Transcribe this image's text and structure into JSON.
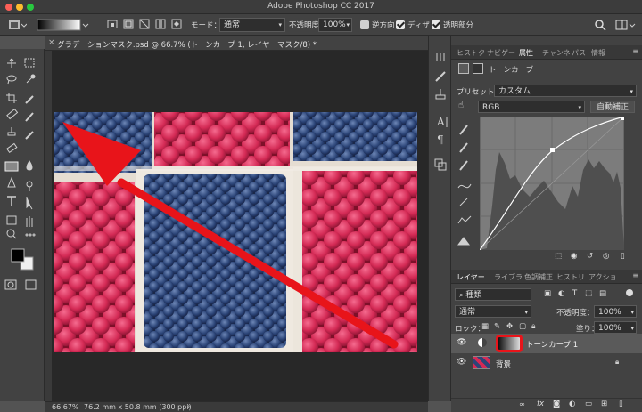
{
  "app": {
    "title": "Adobe Photoshop CC 2017"
  },
  "options_bar": {
    "mode_label": "モード：",
    "mode_value": "通常",
    "opacity_label": "不透明度：",
    "opacity_value": "100%",
    "reverse_label": "逆方向",
    "dither_label": "ディザ",
    "transparency_label": "透明部分"
  },
  "document": {
    "tab_title": "グラデーションマスク.psd @ 66.7% (トーンカーブ 1, レイヤーマスク/8) *",
    "zoom": "66.67%",
    "size_info": "76.2 mm x 50.8 mm (300 ppi)"
  },
  "properties_panel": {
    "tabs": [
      "ヒストク",
      "ナビゲー",
      "属性",
      "チャンネ",
      "パス",
      "情報"
    ],
    "active_tab": "属性",
    "header_label": "トーンカーブ",
    "preset_label": "プリセット：",
    "preset_value": "カスタム",
    "channel_value": "RGB",
    "auto_button": "自動補正"
  },
  "layers_panel": {
    "tabs": [
      "レイヤー",
      "ライブラ",
      "色調補正",
      "ヒストリ",
      "アクショ"
    ],
    "active_tab": "レイヤー",
    "filter_value": "種類",
    "blend_mode": "通常",
    "opacity_label": "不透明度：",
    "opacity_value": "100%",
    "lock_label": "ロック：",
    "fill_label": "塗り：",
    "fill_value": "100%",
    "layers": [
      {
        "name": "トーンカーブ 1"
      },
      {
        "name": "背景"
      }
    ]
  },
  "colors": {
    "arrow": "#e8141a",
    "highlight": "#e8141a"
  }
}
